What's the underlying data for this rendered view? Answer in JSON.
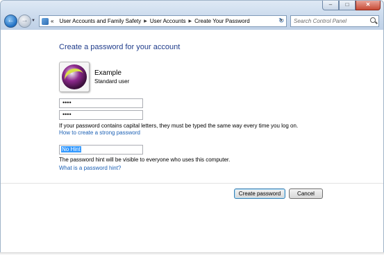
{
  "window": {
    "minimize_label": "–",
    "maximize_label": "□",
    "close_label": "✕"
  },
  "nav": {
    "back_label": "←",
    "forward_label": "→",
    "breadcrumb_overflow": "«",
    "breadcrumbs": [
      "User Accounts and Family Safety",
      "User Accounts",
      "Create Your Password"
    ],
    "search_placeholder": "Search Control Panel"
  },
  "main": {
    "heading": "Create a password for your account",
    "user": {
      "name": "Example",
      "type": "Standard user"
    },
    "new_password_value": "••••",
    "confirm_password_value": "••••",
    "case_note": "If your password contains capital letters, they must be typed the same way every time you log on.",
    "strong_password_link": "How to create a strong password",
    "hint_value": "No Hint",
    "hint_note": "The password hint will be visible to everyone who uses this computer.",
    "hint_link": "What is a password hint?"
  },
  "buttons": {
    "create": "Create password",
    "cancel": "Cancel"
  }
}
